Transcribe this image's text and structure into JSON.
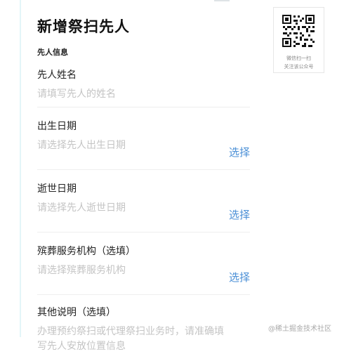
{
  "page": {
    "title": "新增祭扫先人",
    "section": "先人信息"
  },
  "fields": [
    {
      "label": "先人姓名",
      "placeholder": "请填写先人的姓名"
    },
    {
      "label": "出生日期",
      "placeholder": "请选择先人出生日期",
      "action": "选择"
    },
    {
      "label": "逝世日期",
      "placeholder": "请选择先人逝世日期",
      "action": "选择"
    },
    {
      "label": "殡葬服务机构（选填）",
      "placeholder": "请选择殡葬服务机构",
      "action": "选择"
    },
    {
      "label": "其他说明（选填）",
      "placeholder_lines": [
        "办理预约祭扫或代理祭扫业务时，请准确填",
        "写先人安放位置信息"
      ]
    }
  ],
  "qr_card": {
    "line1": "微信扫一扫",
    "line2": "关注该公众号"
  },
  "watermark": "@稀土掘金技术社区",
  "colors": {
    "accent": "#4a8fd6",
    "placeholder": "#c4c4c4",
    "divider": "#eeeeee"
  }
}
